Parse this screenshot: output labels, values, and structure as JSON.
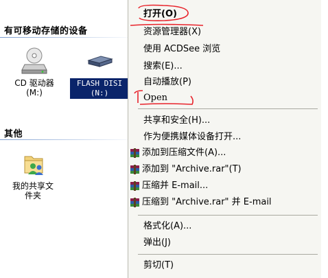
{
  "sections": {
    "removable_title": "有可移动存储的设备",
    "other_title": "其他"
  },
  "drives": [
    {
      "label_line1": "CD 驱动器",
      "label_line2": "(M:)",
      "icon": "cd-drive-icon"
    },
    {
      "label_line1": "FLASH DISI",
      "label_line2": "(N:)",
      "icon": "flash-drive-icon",
      "selected": true
    }
  ],
  "shared": {
    "label_line1": "我的共享文",
    "label_line2": "件夹",
    "icon": "shared-folder-icon"
  },
  "menu": {
    "items": [
      {
        "label": "打开(O)"
      },
      {
        "label": "资源管理器(X)"
      },
      {
        "label": "使用 ACDSee 浏览"
      },
      {
        "label": "搜索(E)..."
      },
      {
        "label": "自动播放(P)"
      },
      {
        "label": "Open"
      },
      {
        "label": "共享和安全(H)..."
      },
      {
        "label": "作为便携媒体设备打开..."
      },
      {
        "label": "添加到压缩文件(A)...",
        "icon": "winrar-icon"
      },
      {
        "label": "添加到 \"Archive.rar\"(T)",
        "icon": "winrar-icon"
      },
      {
        "label": "压缩并 E-mail...",
        "icon": "winrar-icon"
      },
      {
        "label": "压缩到 \"Archive.rar\" 并 E-mail",
        "icon": "winrar-icon"
      },
      {
        "label": "格式化(A)..."
      },
      {
        "label": "弹出(J)"
      },
      {
        "label": "剪切(T)"
      }
    ]
  },
  "colors": {
    "selection": "#0a246a",
    "menu_bg": "#f6f6f2",
    "annotation": "#e8222a"
  }
}
